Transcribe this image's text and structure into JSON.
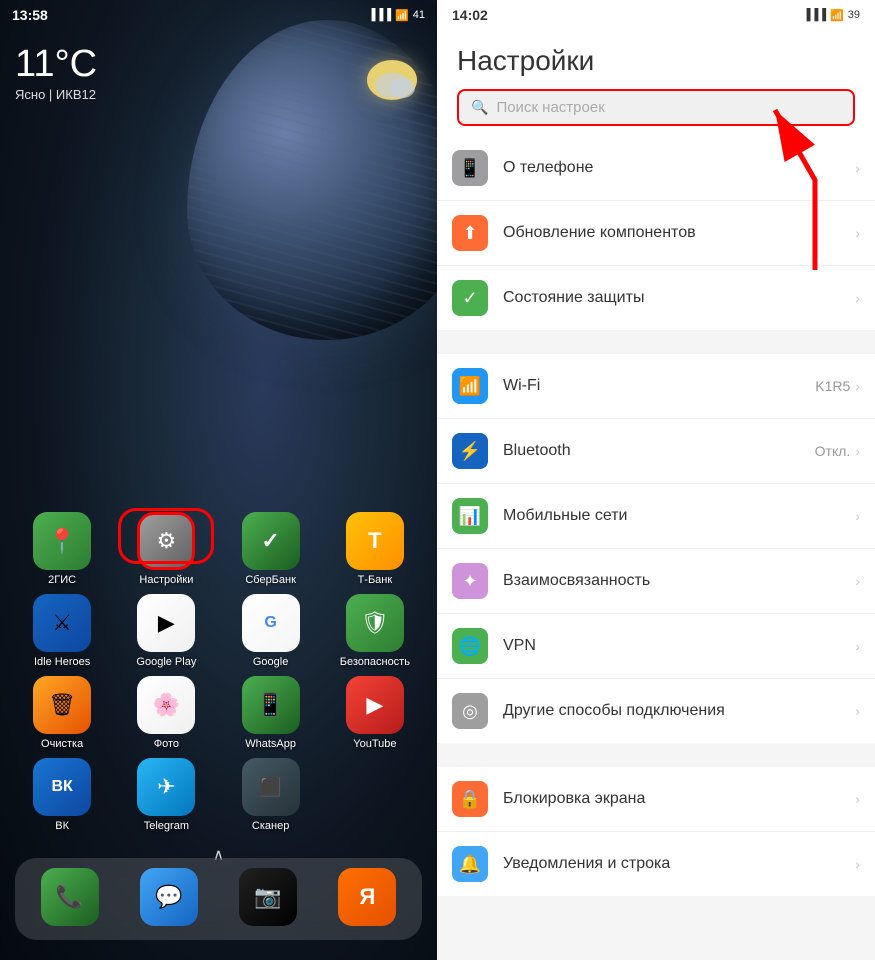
{
  "left_screen": {
    "time": "13:58",
    "status_icons": "▐▐▐ ⦿ 41",
    "weather": {
      "temp": "11°C",
      "desc": "Ясно | ИКВ12"
    },
    "app_rows": [
      [
        {
          "id": "2gis",
          "label": "2ГИС",
          "icon": "🗺",
          "class": "icon-2gis"
        },
        {
          "id": "settings",
          "label": "Настройки",
          "icon": "⚙",
          "class": "icon-settings",
          "highlighted": true
        },
        {
          "id": "sber",
          "label": "СберБанк",
          "icon": "✓",
          "class": "icon-sber"
        },
        {
          "id": "tbank",
          "label": "Т-Банк",
          "icon": "Т",
          "class": "icon-tbank"
        }
      ],
      [
        {
          "id": "idle",
          "label": "Idle Heroes",
          "icon": "🎮",
          "class": "icon-idle"
        },
        {
          "id": "gplay",
          "label": "Google Play",
          "icon": "▶",
          "class": "icon-gplay"
        },
        {
          "id": "google",
          "label": "Google",
          "icon": "G",
          "class": "icon-google"
        },
        {
          "id": "security",
          "label": "Безопасность",
          "icon": "🛡",
          "class": "icon-security"
        }
      ],
      [
        {
          "id": "clean",
          "label": "Очистка",
          "icon": "🗑",
          "class": "icon-clean"
        },
        {
          "id": "photo",
          "label": "Фото",
          "icon": "🌸",
          "class": "icon-photo"
        },
        {
          "id": "whatsapp",
          "label": "WhatsApp",
          "icon": "📱",
          "class": "icon-whatsapp"
        },
        {
          "id": "youtube",
          "label": "YouTube",
          "icon": "▶",
          "class": "icon-youtube"
        }
      ],
      [
        {
          "id": "vk",
          "label": "ВК",
          "icon": "ВК",
          "class": "icon-vk"
        },
        {
          "id": "telegram",
          "label": "Telegram",
          "icon": "✈",
          "class": "icon-telegram"
        },
        {
          "id": "scanner",
          "label": "Сканер",
          "icon": "⬛",
          "class": "icon-scanner"
        },
        {
          "id": "empty",
          "label": "",
          "icon": "",
          "class": ""
        }
      ]
    ],
    "dock": [
      {
        "id": "phone",
        "label": "",
        "icon": "📞",
        "class": "icon-phone"
      },
      {
        "id": "messages",
        "label": "",
        "icon": "💬",
        "class": "icon-messages"
      },
      {
        "id": "camera",
        "label": "",
        "icon": "📷",
        "class": "icon-camera"
      },
      {
        "id": "yandex",
        "label": "",
        "icon": "Я",
        "class": "icon-yandex"
      }
    ]
  },
  "right_screen": {
    "time": "14:02",
    "status_icons": "▐▐▐ ⦿ 39",
    "title": "Настройки",
    "search_placeholder": "Поиск настроек",
    "sections": [
      {
        "items": [
          {
            "id": "about",
            "icon": "📱",
            "icon_class": "si-phone",
            "label": "О телефоне",
            "value": ""
          },
          {
            "id": "update",
            "icon": "⬆",
            "icon_class": "si-update",
            "label": "Обновление компонентов",
            "value": ""
          },
          {
            "id": "security_status",
            "icon": "✓",
            "icon_class": "si-security",
            "label": "Состояние защиты",
            "value": ""
          }
        ]
      },
      {
        "items": [
          {
            "id": "wifi",
            "icon": "📶",
            "icon_class": "si-wifi",
            "label": "Wi-Fi",
            "value": "K1R5"
          },
          {
            "id": "bluetooth",
            "icon": "⚡",
            "icon_class": "si-bluetooth",
            "label": "Bluetooth",
            "value": "Откл."
          },
          {
            "id": "mobile",
            "icon": "📊",
            "icon_class": "si-mobile",
            "label": "Мобильные сети",
            "value": ""
          },
          {
            "id": "connect",
            "icon": "✦",
            "icon_class": "si-connect",
            "label": "Взаимосвязанность",
            "value": ""
          },
          {
            "id": "vpn",
            "icon": "🌐",
            "icon_class": "si-vpn",
            "label": "VPN",
            "value": ""
          },
          {
            "id": "other_conn",
            "icon": "◎",
            "icon_class": "si-other",
            "label": "Другие способы подключения",
            "value": ""
          }
        ]
      },
      {
        "items": [
          {
            "id": "lock",
            "icon": "🔒",
            "icon_class": "si-lock",
            "label": "Блокировка экрана",
            "value": ""
          },
          {
            "id": "notify",
            "icon": "🔔",
            "icon_class": "si-notify",
            "label": "Уведомления и строка",
            "value": ""
          }
        ]
      }
    ]
  }
}
